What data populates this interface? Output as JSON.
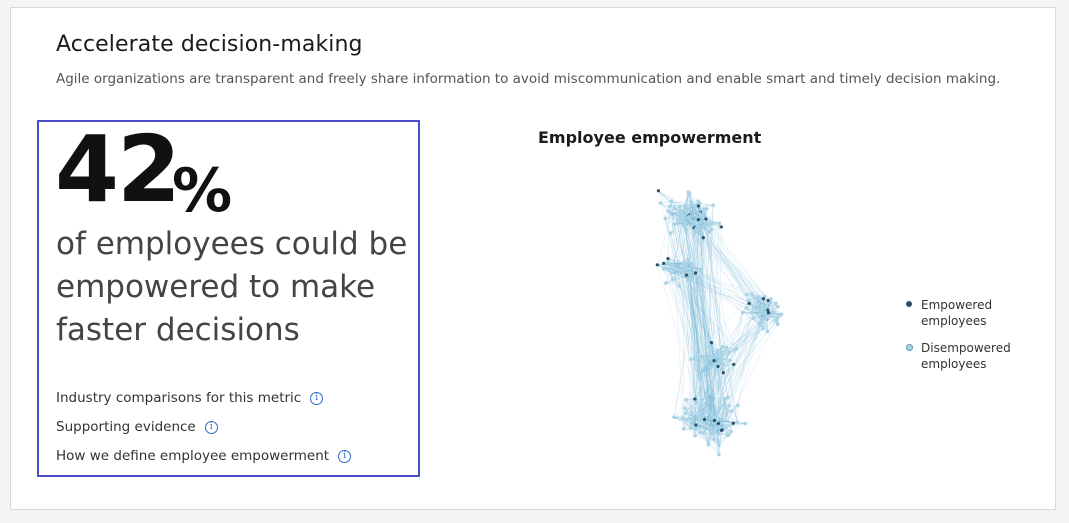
{
  "header": {
    "title": "Accelerate decision-making",
    "subtitle": "Agile organizations are transparent and freely share information to avoid miscommunication and enable smart and timely decision making."
  },
  "stat": {
    "value": "42",
    "unit": "%",
    "description": "of employees could be empowered to make faster decisions"
  },
  "links": [
    {
      "label": "Industry comparisons for this metric"
    },
    {
      "label": "Supporting evidence"
    },
    {
      "label": "How we define employee empowerment"
    }
  ],
  "chart_data": {
    "type": "network",
    "title": "Employee empowerment",
    "legend": [
      {
        "name": "Empowered employees",
        "color": "#2f5068"
      },
      {
        "name": "Disempowered employees",
        "color": "#a9d3e6"
      }
    ],
    "empowered_share": 0.42,
    "legend_position": "right"
  },
  "colors": {
    "accent_border": "#4a4fc9",
    "info_icon": "#2b6cc4",
    "edge": "#6fb3d4"
  }
}
